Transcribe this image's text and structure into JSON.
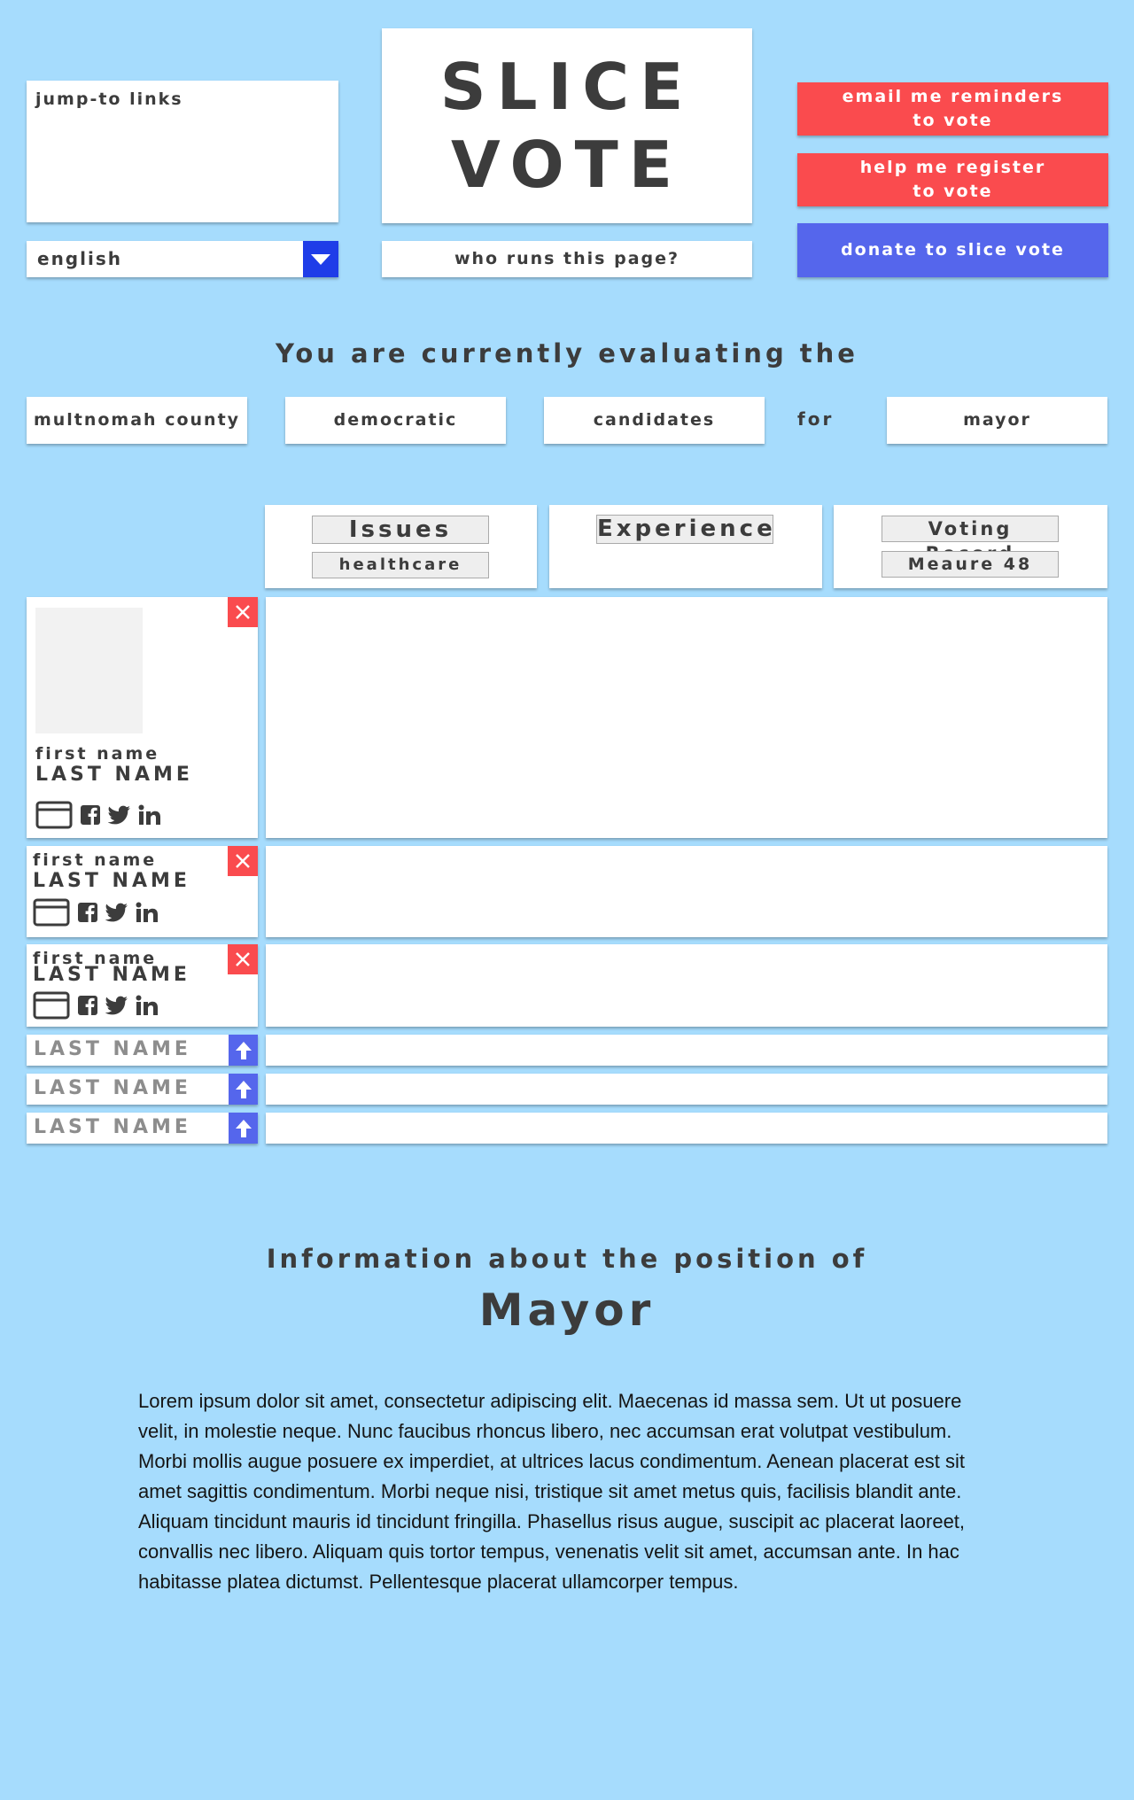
{
  "header": {
    "jump_to_label": "jump-to links",
    "language": "english",
    "logo_line1": "SLICE",
    "logo_line2": "VOTE",
    "who_runs": "who runs this page?",
    "email_btn_line1": "email me reminders",
    "email_btn_line2": "to vote",
    "register_btn_line1": "help me register",
    "register_btn_line2": "to vote",
    "donate_btn": "donate to slice vote",
    "colors": {
      "background": "#a6dcfd",
      "red": "#fa4b4e",
      "blue": "#5566ec",
      "select_arrow": "#1f3de8"
    }
  },
  "evaluation": {
    "heading": "You are currently evaluating the",
    "county": "multnomah county",
    "party": "democratic",
    "type": "candidates",
    "for_word": "for",
    "office": "mayor"
  },
  "tabs": {
    "issues": {
      "label": "Issues",
      "sub": "healthcare"
    },
    "experience": {
      "label": "Experience"
    },
    "voting_record": {
      "label": "Voting Record",
      "sub": "Meaure 48"
    }
  },
  "candidates": [
    {
      "first": "first name",
      "last": "LAST NAME"
    },
    {
      "first": "first name",
      "last": "LAST NAME"
    },
    {
      "first": "first name",
      "last": "LAST NAME"
    }
  ],
  "collapsed_candidates": [
    {
      "last": "LAST NAME"
    },
    {
      "last": "LAST NAME"
    },
    {
      "last": "LAST NAME"
    }
  ],
  "icons": {
    "remove": "close-icon",
    "website": "browser-window-icon",
    "facebook": "facebook-icon",
    "twitter": "twitter-icon",
    "linkedin": "linkedin-icon",
    "promote": "arrow-up-icon",
    "dropdown": "chevron-down-icon"
  },
  "info": {
    "heading": "Information about the position of",
    "title": "Mayor",
    "body": "Lorem ipsum dolor sit amet, consectetur adipiscing elit. Maecenas id massa sem. Ut ut posuere velit, in molestie neque. Nunc faucibus rhoncus libero, nec accumsan erat volutpat vestibulum. Morbi mollis augue posuere ex imperdiet, at ultrices lacus condimentum. Aenean placerat est sit amet sagittis condimentum. Morbi neque nisi, tristique sit amet metus quis, facilisis blandit ante. Aliquam tincidunt mauris id tincidunt fringilla. Phasellus risus augue, suscipit ac placerat laoreet, convallis nec libero. Aliquam quis tortor tempus, venenatis velit sit amet, accumsan ante. In hac habitasse platea dictumst. Pellentesque placerat ullamcorper tempus."
  }
}
